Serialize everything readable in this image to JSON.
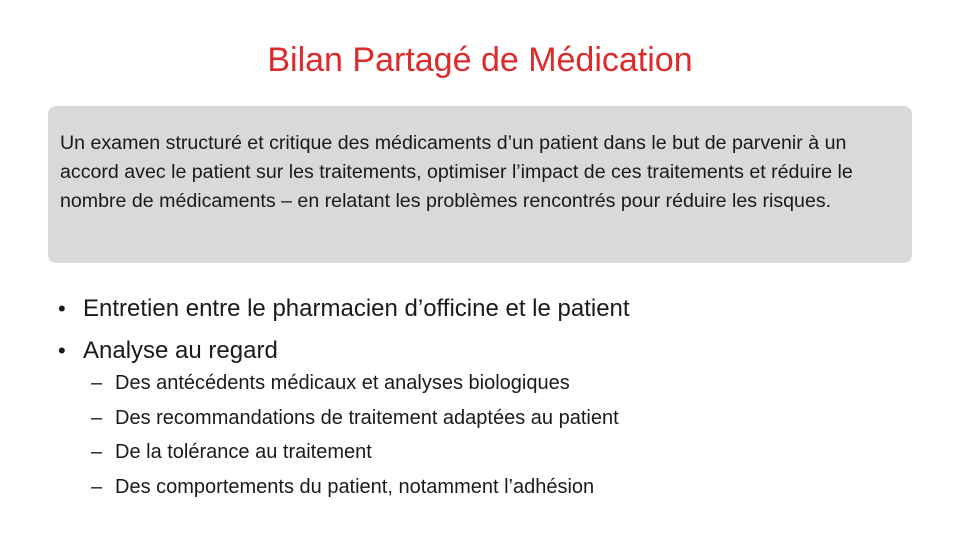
{
  "slide": {
    "title": "Bilan Partagé de Médication",
    "definition": "Un examen structuré et critique des médicaments d’un patient dans le but de parvenir à un accord avec le patient sur les traitements, optimiser l’impact de ces traitements et réduire le nombre de médicaments – en relatant les problèmes rencontrés pour réduire les risques.",
    "bullet_marker": "•",
    "sub_marker": "–",
    "bullets": [
      "Entretien entre le pharmacien d’officine et le patient",
      "Analyse au regard"
    ],
    "sub_bullets": [
      "Des antécédents médicaux et analyses biologiques",
      "Des recommandations de traitement adaptées au patient",
      "De la tolérance au traitement",
      "Des comportements du patient, notamment l’adhésion"
    ],
    "colors": {
      "title": "#dd2a2a",
      "box_background": "#d9d9d9",
      "text": "#1a1a1a"
    }
  }
}
